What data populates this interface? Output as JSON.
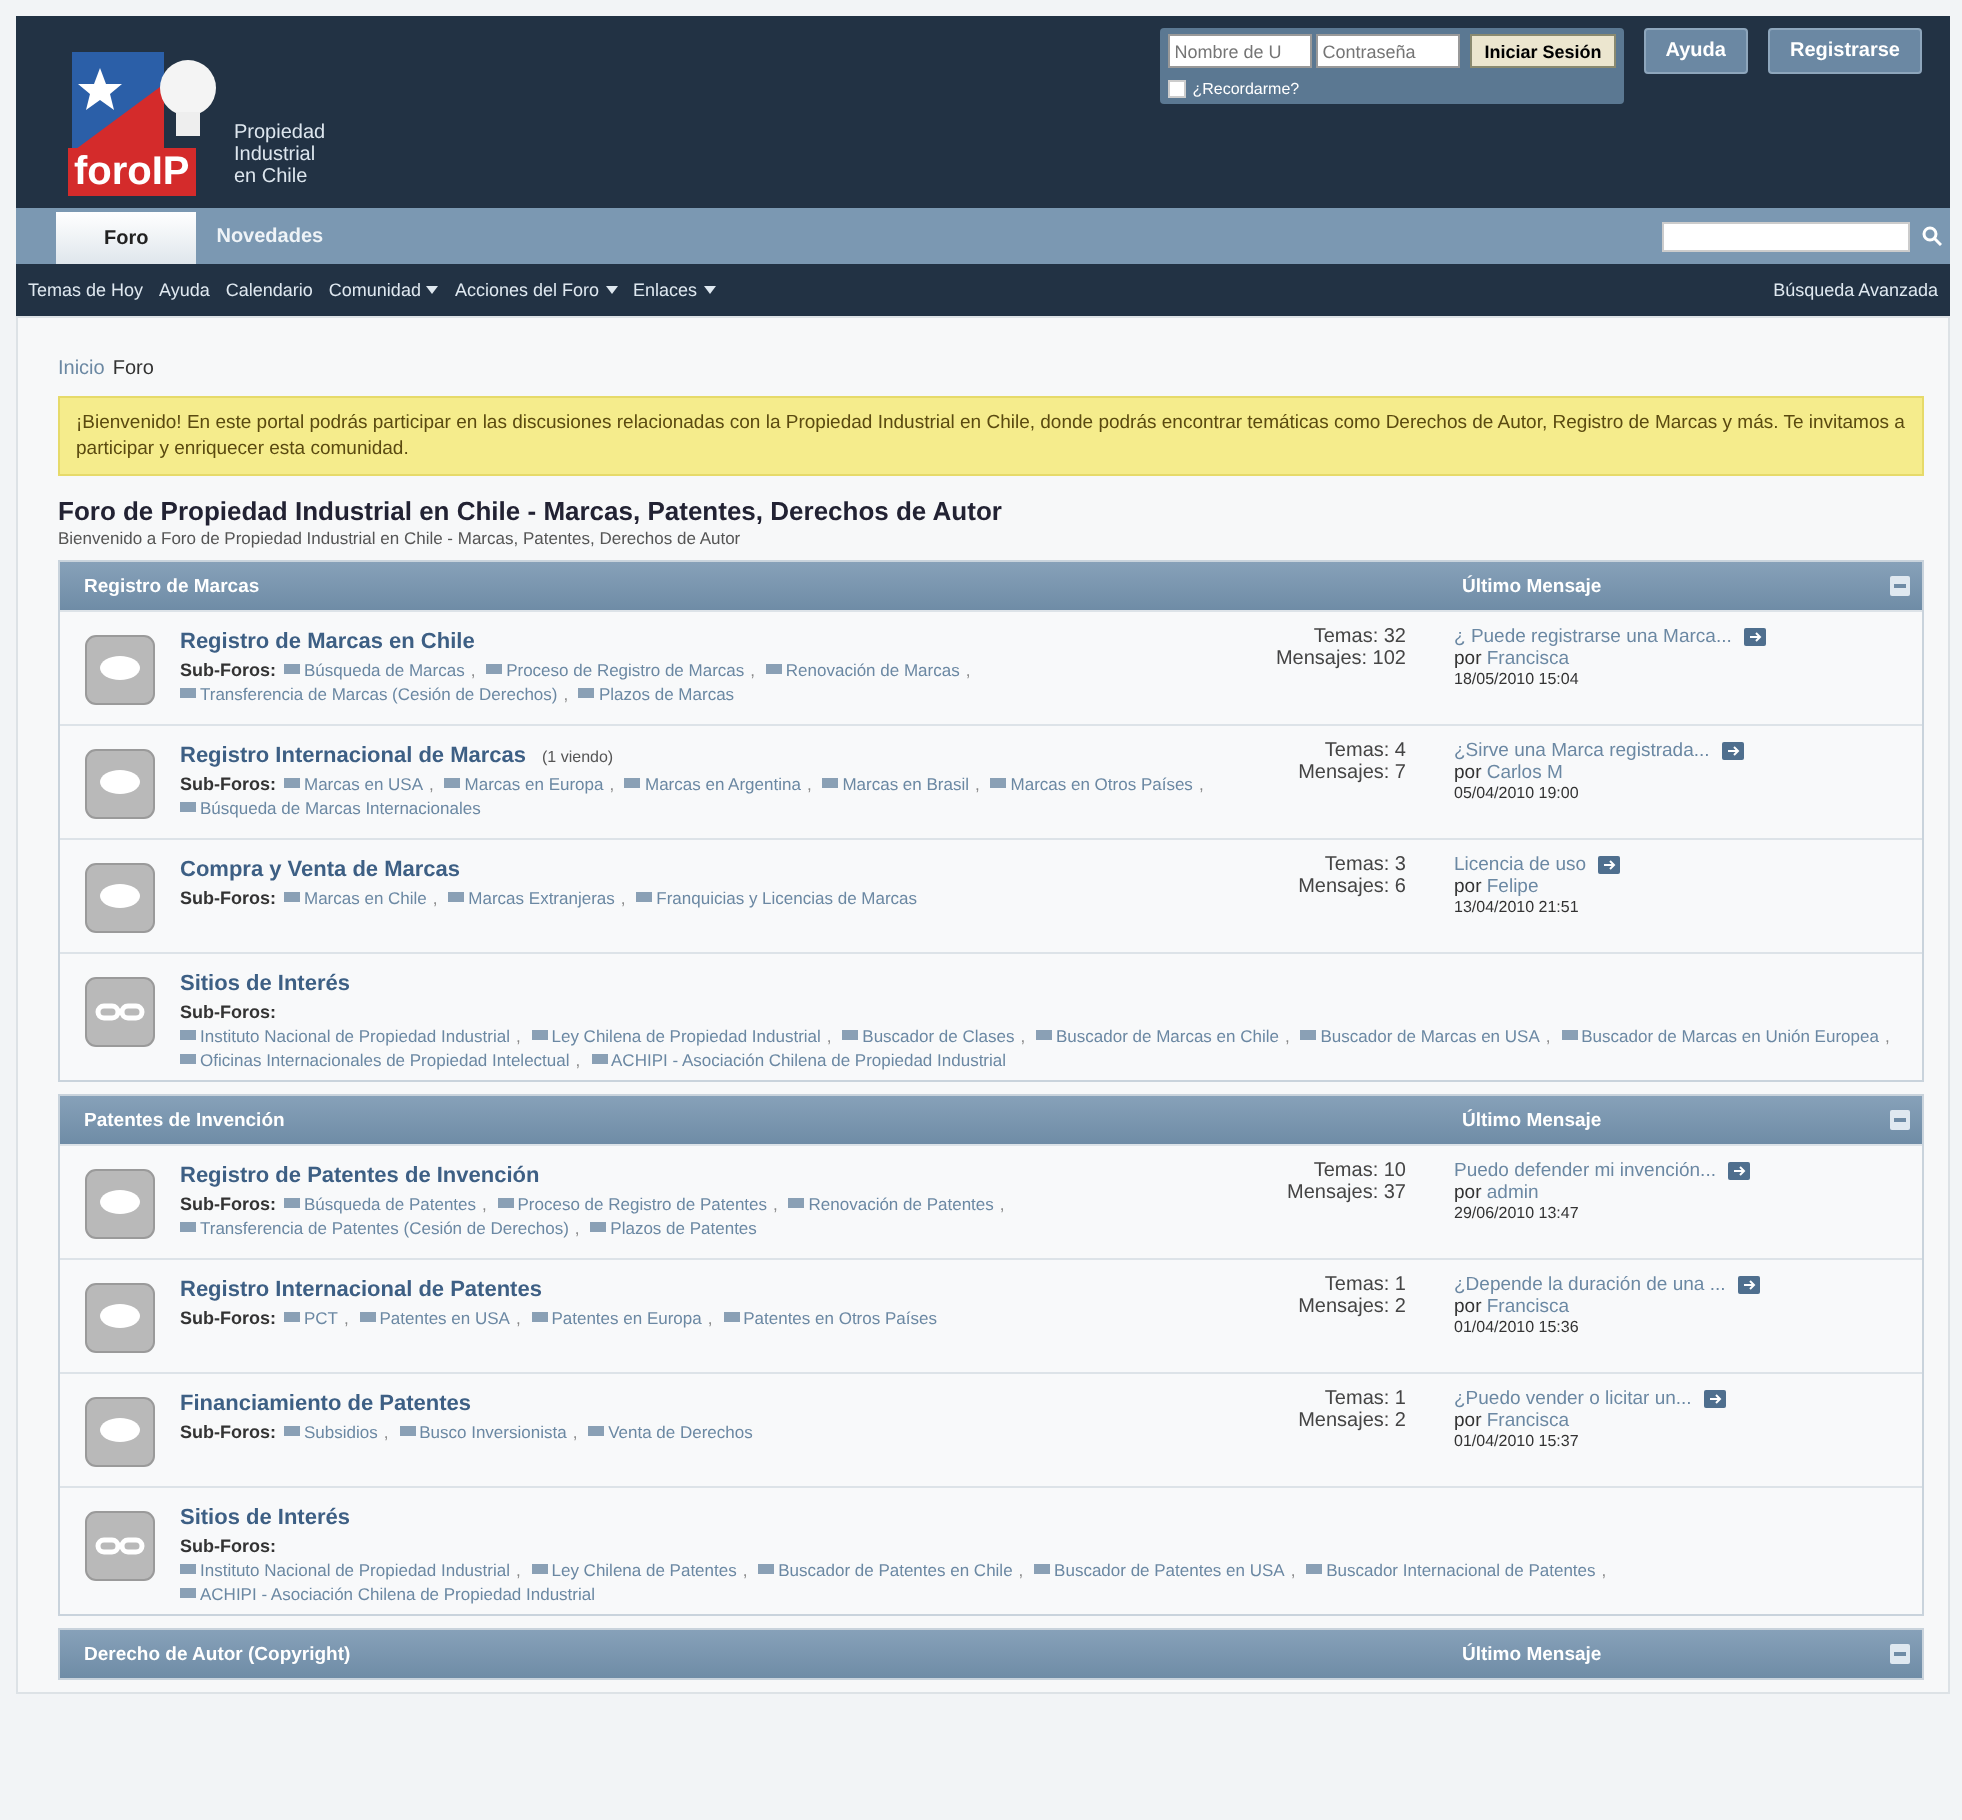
{
  "header": {
    "logo": {
      "brand": "foroIP",
      "tagline_lines": [
        "Propiedad",
        "Industrial",
        "en Chile"
      ]
    },
    "login": {
      "username_placeholder": "Nombre de U",
      "password_placeholder": "Contraseña",
      "submit": "Iniciar Sesión",
      "remember": {
        "label": "¿Recordarme?",
        "checked": false
      }
    },
    "buttons": [
      "Ayuda",
      "Registrarse"
    ]
  },
  "tabs": [
    {
      "label": "Foro",
      "selected": true
    },
    {
      "label": "Novedades",
      "selected": false
    }
  ],
  "subnav": {
    "items": [
      {
        "label": "Temas de Hoy",
        "dropdown": false
      },
      {
        "label": "Ayuda",
        "dropdown": false
      },
      {
        "label": "Calendario",
        "dropdown": false
      },
      {
        "label": "Comunidad",
        "dropdown": true
      },
      {
        "label": "Acciones del Foro",
        "dropdown": true
      },
      {
        "label": "Enlaces",
        "dropdown": true
      }
    ],
    "advanced_search": "Búsqueda Avanzada"
  },
  "breadcrumb": [
    "Inicio",
    "Foro"
  ],
  "subforum_separator": ",",
  "notice": "¡Bienvenido! En este portal podrás participar en las discusiones relacionadas con la Propiedad Industrial en Chile, donde podrás encontrar temáticas como Derechos de Autor, Registro de Marcas y más. Te invitamos a participar y enriquecer esta comunidad.",
  "forum_title": "Foro de Propiedad Industrial en Chile - Marcas, Patentes, Derechos de Autor",
  "forum_subtitle": "Bienvenido a Foro de Propiedad Industrial en Chile - Marcas, Patentes, Derechos de Autor",
  "sections": [
    {
      "name": "Registro de Marcas",
      "last_post_heading": "Último Mensaje",
      "forums": [
        {
          "kind": "forum",
          "title": "Registro de Marcas en Chile",
          "subforums_label": "Sub-Foros:",
          "subforums": [
            "Búsqueda de Marcas",
            "Proceso de Registro de Marcas",
            "Renovación de Marcas",
            "Transferencia de Marcas (Cesión de Derechos)",
            "Plazos de Marcas"
          ],
          "topics": "Temas: 32",
          "posts": "Mensajes: 102",
          "last_post": {
            "title": "¿ Puede registrarse una Marca...",
            "by": "por",
            "author": "Francisca",
            "date": "18/05/2010 15:04"
          }
        },
        {
          "kind": "forum",
          "title": "Registro Internacional de Marcas",
          "viewing": "(1 viendo)",
          "subforums_label": "Sub-Foros:",
          "subforums": [
            "Marcas en USA",
            "Marcas en Europa",
            "Marcas en Argentina",
            "Marcas en Brasil",
            "Marcas en Otros Países",
            "Búsqueda de Marcas Internacionales"
          ],
          "topics": "Temas: 4",
          "posts": "Mensajes: 7",
          "last_post": {
            "title": "¿Sirve una Marca registrada...",
            "by": "por",
            "author": "Carlos M",
            "date": "05/04/2010 19:00"
          }
        },
        {
          "kind": "forum",
          "title": "Compra y Venta de Marcas",
          "subforums_label": "Sub-Foros:",
          "subforums": [
            "Marcas en Chile",
            "Marcas Extranjeras",
            "Franquicias y Licencias de Marcas"
          ],
          "topics": "Temas: 3",
          "posts": "Mensajes: 6",
          "last_post": {
            "title": "Licencia de uso",
            "by": "por",
            "author": "Felipe",
            "date": "13/04/2010 21:51"
          }
        },
        {
          "kind": "links",
          "title": "Sitios de Interés",
          "subforums_label": "Sub-Foros:",
          "subforums": [
            "Instituto Nacional de Propiedad Industrial",
            "Ley Chilena de Propiedad Industrial",
            "Buscador de Clases",
            "Buscador de Marcas en Chile",
            "Buscador de Marcas en USA",
            "Buscador de Marcas en Unión Europea",
            "Oficinas Internacionales de Propiedad Intelectual",
            "ACHIPI - Asociación Chilena de Propiedad Industrial"
          ]
        }
      ]
    },
    {
      "name": "Patentes de Invención",
      "last_post_heading": "Último Mensaje",
      "forums": [
        {
          "kind": "forum",
          "title": "Registro de Patentes de Invención",
          "subforums_label": "Sub-Foros:",
          "subforums": [
            "Búsqueda de Patentes",
            "Proceso de Registro de Patentes",
            "Renovación de Patentes",
            "Transferencia de Patentes (Cesión de Derechos)",
            "Plazos de Patentes"
          ],
          "topics": "Temas: 10",
          "posts": "Mensajes: 37",
          "last_post": {
            "title": "Puedo defender mi invención...",
            "by": "por",
            "author": "admin",
            "date": "29/06/2010 13:47"
          }
        },
        {
          "kind": "forum",
          "title": "Registro Internacional de Patentes",
          "subforums_label": "Sub-Foros:",
          "subforums": [
            "PCT",
            "Patentes en USA",
            "Patentes en Europa",
            "Patentes en Otros Países"
          ],
          "topics": "Temas: 1",
          "posts": "Mensajes: 2",
          "last_post": {
            "title": "¿Depende la duración de una ...",
            "by": "por",
            "author": "Francisca",
            "date": "01/04/2010 15:36"
          }
        },
        {
          "kind": "forum",
          "title": "Financiamiento de Patentes",
          "subforums_label": "Sub-Foros:",
          "subforums": [
            "Subsidios",
            "Busco Inversionista",
            "Venta de Derechos"
          ],
          "topics": "Temas: 1",
          "posts": "Mensajes: 2",
          "last_post": {
            "title": "¿Puedo vender o licitar un...",
            "by": "por",
            "author": "Francisca",
            "date": "01/04/2010 15:37"
          }
        },
        {
          "kind": "links",
          "title": "Sitios de Interés",
          "subforums_label": "Sub-Foros:",
          "subforums": [
            "Instituto Nacional de Propiedad Industrial",
            "Ley Chilena de Patentes",
            "Buscador de Patentes en Chile",
            "Buscador de Patentes en USA",
            "Buscador Internacional de Patentes",
            "ACHIPI - Asociación Chilena de Propiedad Industrial"
          ]
        }
      ]
    },
    {
      "name": "Derecho de Autor (Copyright)",
      "last_post_heading": "Último Mensaje"
    }
  ]
}
